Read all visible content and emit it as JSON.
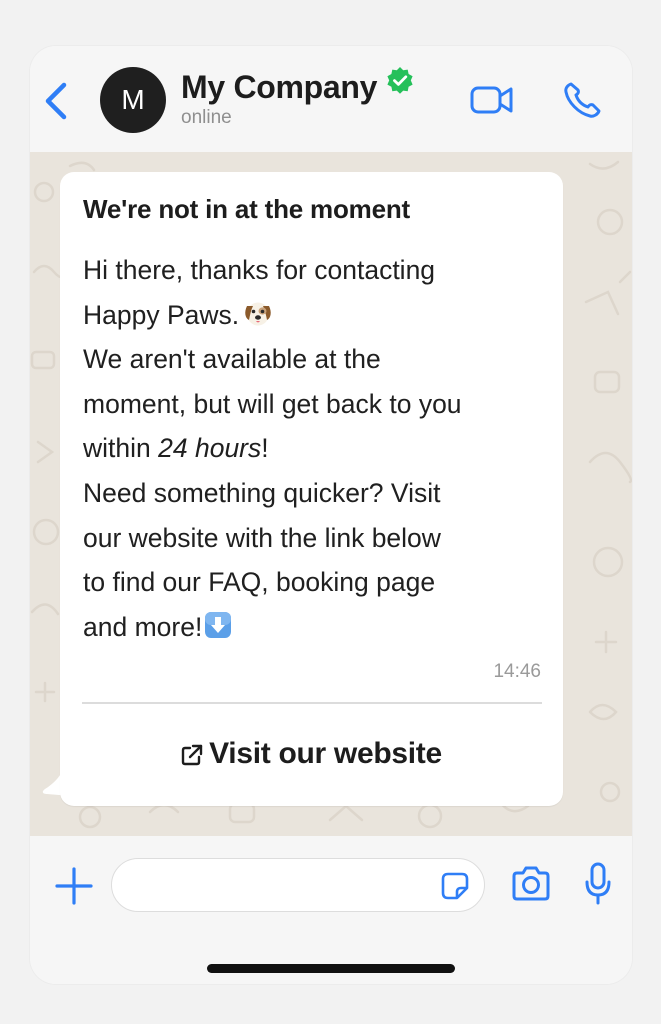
{
  "header": {
    "avatar_letter": "M",
    "contact_name": "My Company",
    "status": "online",
    "verified_badge_icon": "verified-check-icon",
    "back_icon": "chevron-left-icon",
    "video_icon": "video-camera-icon",
    "call_icon": "phone-icon"
  },
  "message": {
    "title": "We're not in at the moment",
    "lines": {
      "l1": "Hi there, thanks for contacting",
      "l2": "Happy Paws.",
      "l3": "We aren't available at the",
      "l4": "moment, but will get back to you",
      "l5_pre": "within ",
      "l5_em": "24 hours",
      "l5_post": "!",
      "l6": "Need something quicker? Visit",
      "l7": "our website with the link below",
      "l8": "to find our FAQ, booking page",
      "l9": "and more!"
    },
    "emoji_after_l2": "dog-face-emoji",
    "emoji_after_l9": "down-arrow-emoji",
    "time": "14:46",
    "button_label": "Visit our website",
    "button_icon": "external-link-icon"
  },
  "composer": {
    "input_value": "",
    "input_placeholder": "",
    "plus_icon": "plus-icon",
    "sticker_icon": "sticker-icon",
    "camera_icon": "camera-icon",
    "mic_icon": "microphone-icon"
  },
  "colors": {
    "accent_blue": "#2f7ef6",
    "verified_green": "#25c05a",
    "chat_background": "#e9e4dc",
    "bubble": "#ffffff",
    "text_primary": "#1d1d1d",
    "text_secondary": "#8f8f8f"
  }
}
